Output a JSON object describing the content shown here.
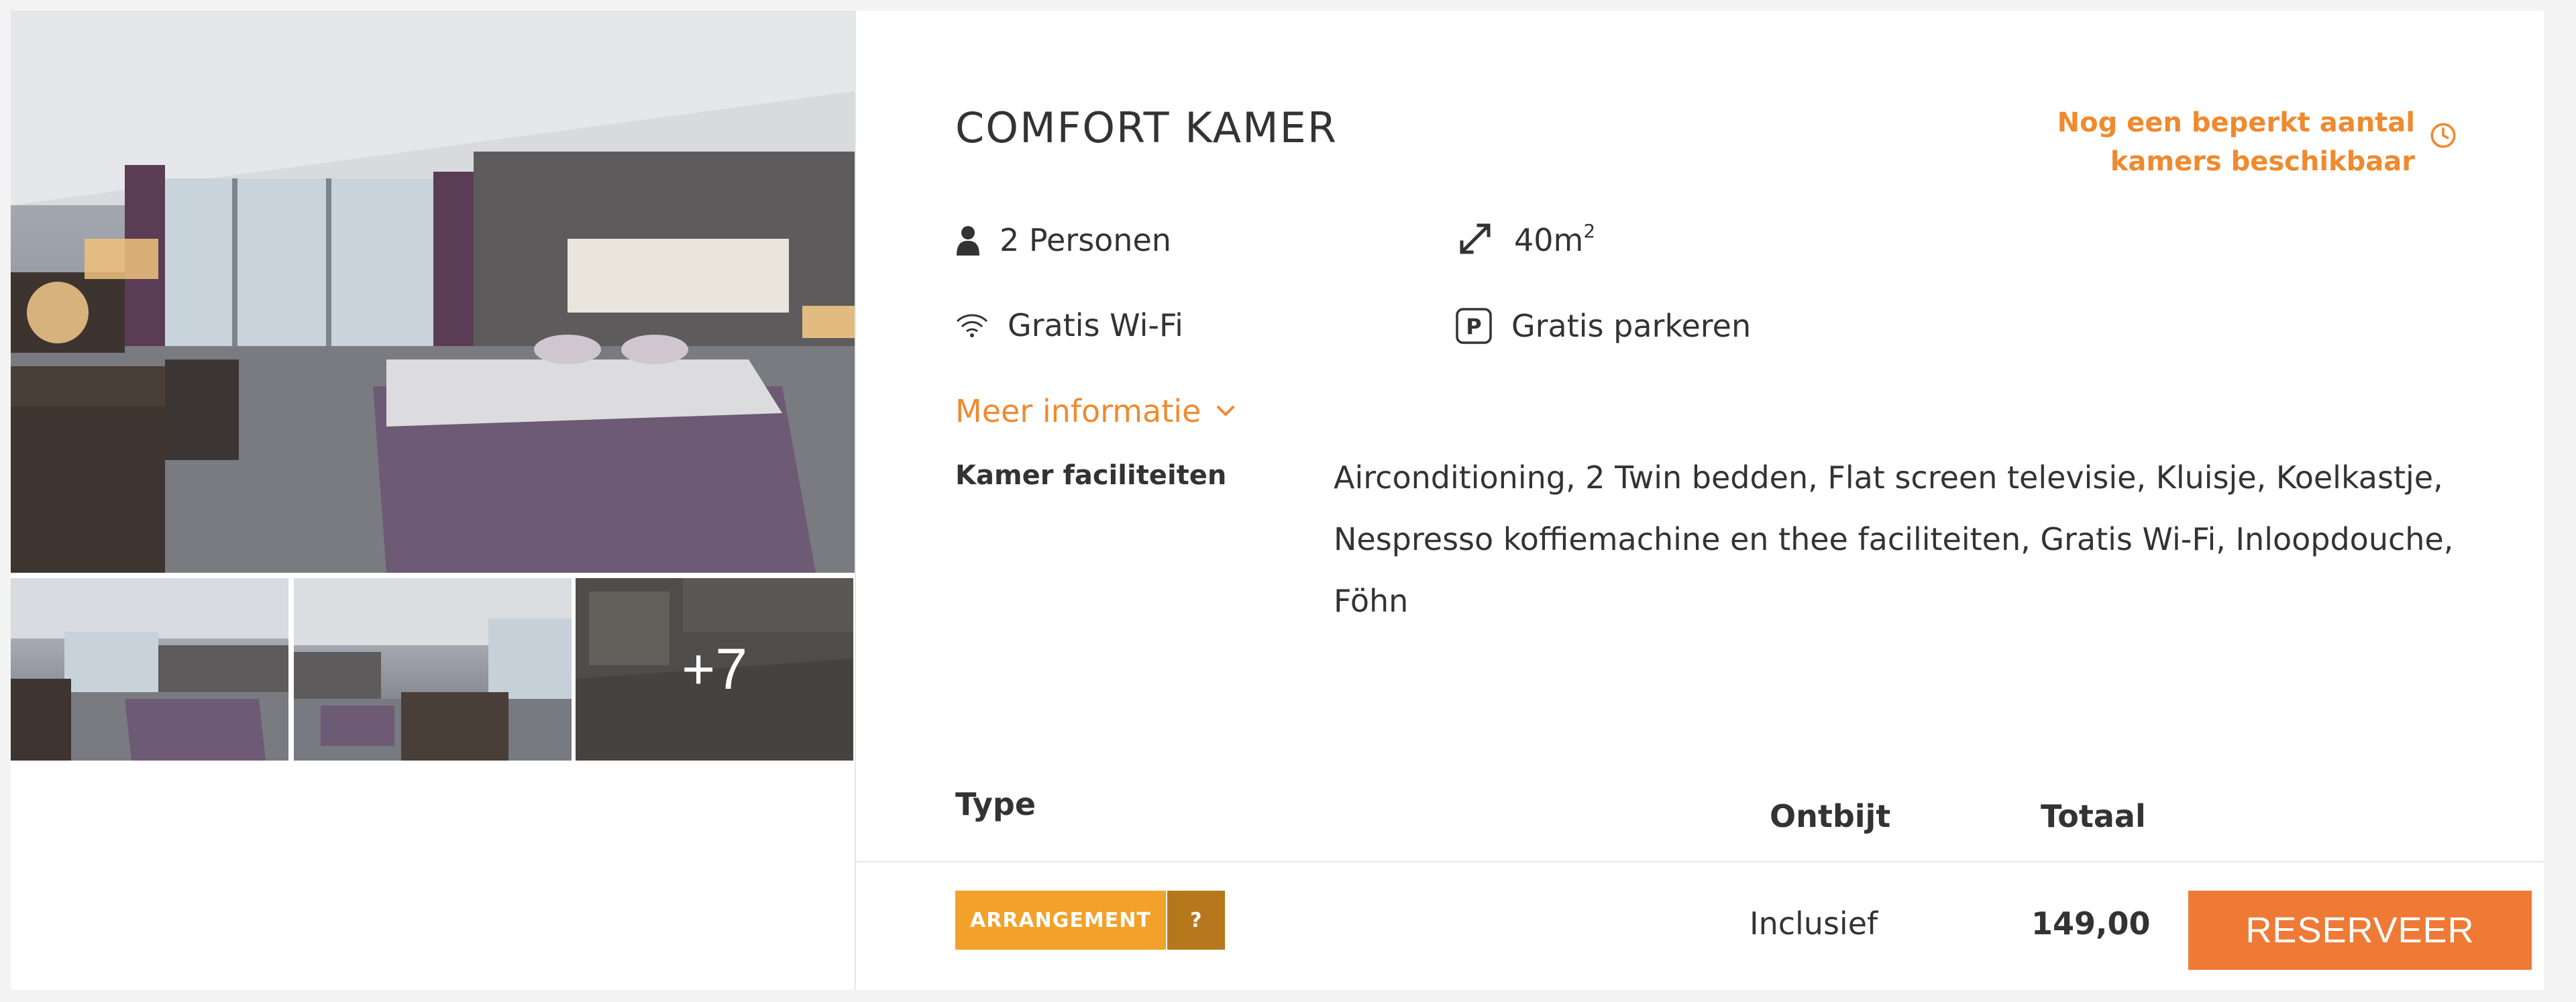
{
  "gallery": {
    "main_photo_alt": "Comfort kamer hotel room photo",
    "more_photos": "+7"
  },
  "room": {
    "title": "COMFORT KAMER",
    "availability": "Nog een beperkt aantal kamers beschikbaar",
    "persons": "2 Personen",
    "size_value": "40m",
    "size_unit_sup": "2",
    "wifi": "Gratis Wi-Fi",
    "parking": "Gratis parkeren",
    "more_info": "Meer informatie",
    "facilities_label": "Kamer faciliteiten",
    "facilities_text": "Airconditioning, 2 Twin bedden, Flat screen televisie, Kluisje, Koelkastje, Nespresso koffiemachine en thee faciliteiten, Gratis Wi-Fi, Inloopdouche, Föhn"
  },
  "rates_table": {
    "headers": {
      "type": "Type",
      "breakfast": "Ontbijt",
      "total": "Totaal"
    },
    "rows": [
      {
        "badge": "ARRANGEMENT",
        "badge_help": "?",
        "breakfast": "Inclusief",
        "total": "149,00",
        "button": "RESERVEER"
      }
    ]
  },
  "colors": {
    "accent": "#ef8a2f",
    "button": "#ef7a35",
    "badge": "#f2a12a",
    "badge_dark": "#b6781c"
  },
  "icons": [
    "person-icon",
    "expand-arrows-icon",
    "wifi-icon",
    "parking-icon",
    "clock-icon",
    "chevron-down-icon"
  ]
}
